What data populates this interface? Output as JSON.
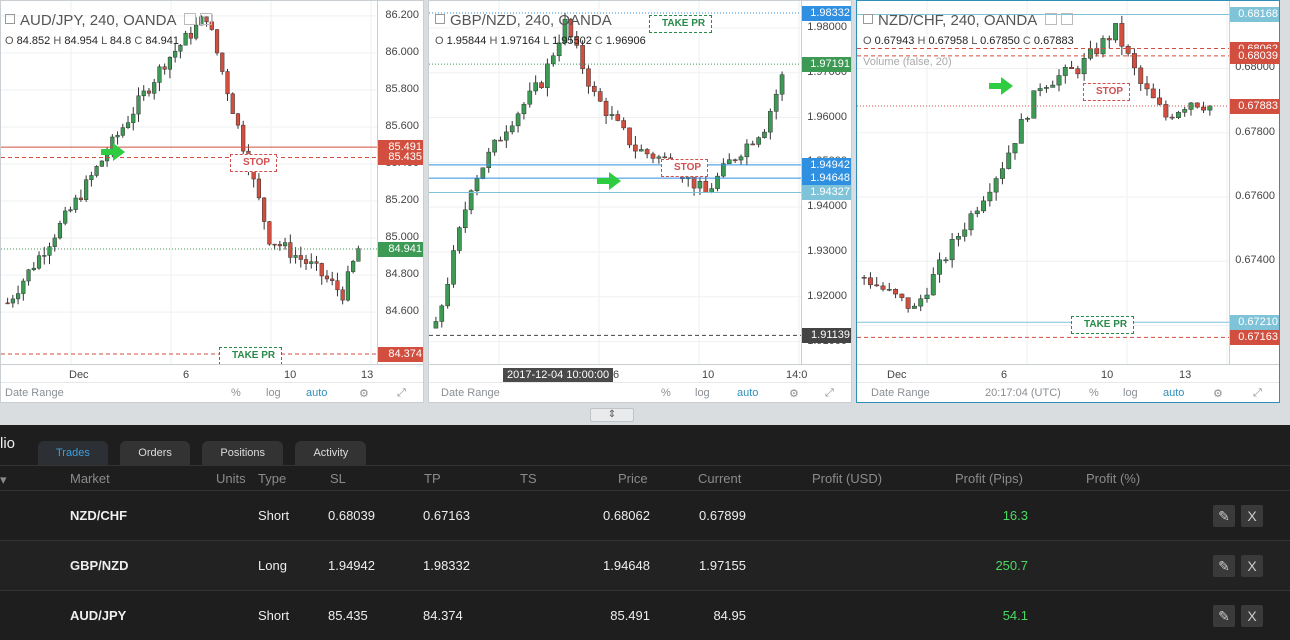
{
  "charts": [
    {
      "title": "AUD/JPY, 240, OANDA",
      "ohlc": {
        "o_label": "O",
        "o": "84.852",
        "h_label": "H",
        "h": "84.954",
        "l_label": "L",
        "l": "84.8",
        "c_label": "C",
        "c": "84.941"
      },
      "price_ticks": [
        "86.200",
        "86.000",
        "85.800",
        "85.600",
        "85.400",
        "85.200",
        "85.000",
        "84.800",
        "84.600"
      ],
      "price_range": [
        84.32,
        86.28
      ],
      "tags": [
        {
          "text": "85.491",
          "value": 85.491,
          "color": "#d24f3f"
        },
        {
          "text": "85.435",
          "value": 85.435,
          "color": "#d24f3f"
        },
        {
          "text": "84.941",
          "value": 84.941,
          "color": "#3d9a55"
        },
        {
          "text": "84.374",
          "value": 84.374,
          "color": "#d24f3f"
        }
      ],
      "time_labels": [
        "Dec",
        "6",
        "10",
        "13"
      ],
      "stop_label": "STOP",
      "tp_label": "TAKE PR",
      "bottom": {
        "date_range": "Date Range",
        "pct": "%",
        "log": "log",
        "auto": "auto"
      }
    },
    {
      "title": "GBP/NZD, 240, OANDA",
      "tp_label": "TAKE PR",
      "ohlc": {
        "o_label": "O",
        "o": "1.95844",
        "h_label": "H",
        "h": "1.97164",
        "l_label": "L",
        "l": "1.95502",
        "c_label": "C",
        "c": "1.96906"
      },
      "price_ticks": [
        "1.98000",
        "1.97000",
        "1.96000",
        "1.95000",
        "1.94000",
        "1.93000",
        "1.92000",
        "1.91000"
      ],
      "price_range": [
        1.905,
        1.986
      ],
      "tags": [
        {
          "text": "1.98332",
          "value": 1.98332,
          "color": "#2f8fe0"
        },
        {
          "text": "1.97191",
          "value": 1.97191,
          "color": "#3d9a55"
        },
        {
          "text": "1.94942",
          "value": 1.94942,
          "color": "#2f8fe0"
        },
        {
          "text": "1.94648",
          "value": 1.94648,
          "color": "#2f8fe0"
        },
        {
          "text": "1.94327",
          "value": 1.94327,
          "color": "#7fc3d8"
        },
        {
          "text": "1.91139",
          "value": 1.91139,
          "color": "#444"
        }
      ],
      "time_labels": [
        "2017-12-04 10:00:00",
        "6",
        "10",
        "14:0"
      ],
      "stop_label": "STOP",
      "bottom": {
        "date_range": "Date Range",
        "pct": "%",
        "log": "log",
        "auto": "auto"
      }
    },
    {
      "title": "NZD/CHF, 240, OANDA",
      "volume": "Volume (false, 20)",
      "ohlc": {
        "o_label": "O",
        "o": "0.67943",
        "h_label": "H",
        "h": "0.67958",
        "l_label": "L",
        "l": "0.67850",
        "c_label": "C",
        "c": "0.67883"
      },
      "price_ticks": [
        "0.68000",
        "0.67800",
        "0.67600",
        "0.67400",
        "0.67200"
      ],
      "price_range": [
        0.6708,
        0.6821
      ],
      "tags": [
        {
          "text": "0.68168",
          "value": 0.68168,
          "color": "#7fc3d8"
        },
        {
          "text": "0.68062",
          "value": 0.68062,
          "color": "#d24f3f"
        },
        {
          "text": "0.68039",
          "value": 0.68039,
          "color": "#d24f3f"
        },
        {
          "text": "0.67883",
          "value": 0.67883,
          "color": "#d24f3f"
        },
        {
          "text": "0.67210",
          "value": 0.6721,
          "color": "#7fc3d8"
        },
        {
          "text": "0.67163",
          "value": 0.67163,
          "color": "#d24f3f"
        }
      ],
      "time_labels": [
        "Dec",
        "6",
        "10",
        "13"
      ],
      "stop_label": "STOP",
      "tp_label": "TAKE PR",
      "bottom": {
        "date_range": "Date Range",
        "clock": "20:17:04 (UTC)",
        "pct": "%",
        "log": "log",
        "auto": "auto"
      }
    }
  ],
  "splitter_glyph": "⇕",
  "portfolio": {
    "title": "lio",
    "tabs": [
      "Trades",
      "Orders",
      "Positions",
      "Activity"
    ],
    "columns": [
      "Market",
      "Units",
      "Type",
      "SL",
      "TP",
      "TS",
      "Price",
      "Current",
      "Profit (USD)",
      "Profit (Pips)",
      "Profit (%)"
    ],
    "rows": [
      {
        "market": "NZD/CHF",
        "type": "Short",
        "sl": "0.68039",
        "tp": "0.67163",
        "price": "0.68062",
        "current": "0.67899",
        "pips": "16.3"
      },
      {
        "market": "GBP/NZD",
        "type": "Long",
        "sl": "1.94942",
        "tp": "1.98332",
        "price": "1.94648",
        "current": "1.97155",
        "pips": "250.7"
      },
      {
        "market": "AUD/JPY",
        "type": "Short",
        "sl": "85.435",
        "tp": "84.374",
        "price": "85.491",
        "current": "84.95",
        "pips": "54.1"
      }
    ],
    "edit_glyph": "✎",
    "close_glyph": "X"
  },
  "colors": {
    "up": "#3d9a55",
    "down": "#d24f3f",
    "accent": "#2f8fe0",
    "arrow": "#2ecc40"
  }
}
